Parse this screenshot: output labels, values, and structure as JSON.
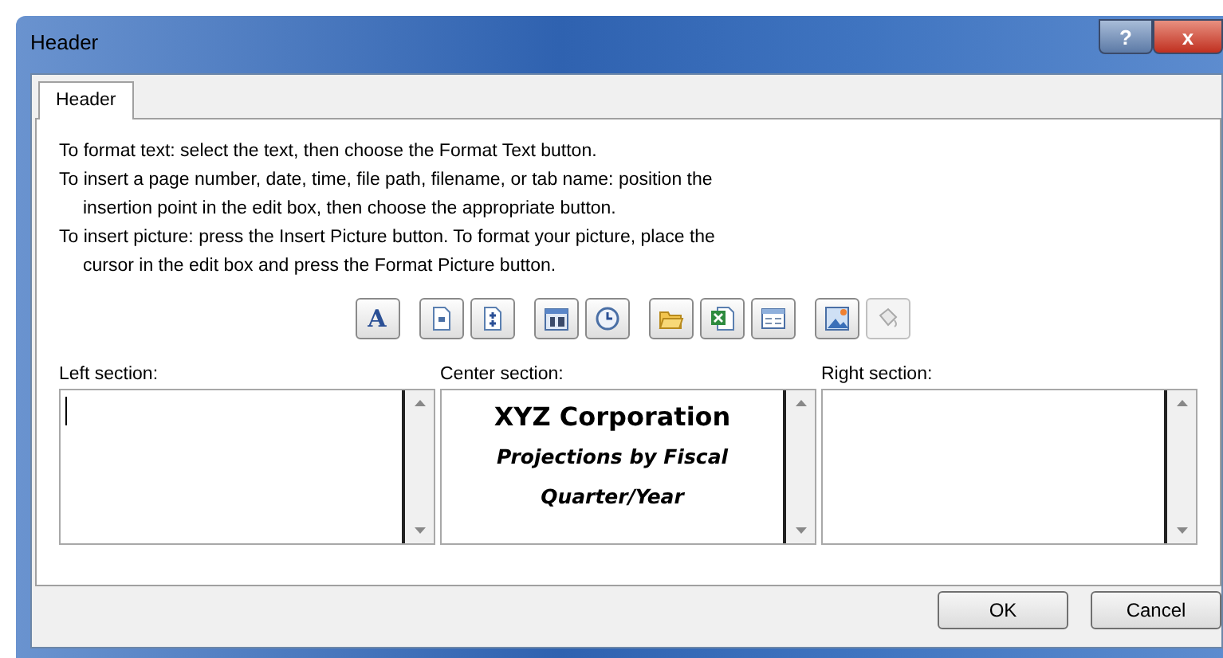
{
  "window": {
    "title": "Header"
  },
  "title_buttons": [
    {
      "kind": "help",
      "glyph": "?"
    },
    {
      "kind": "close",
      "glyph": "x"
    }
  ],
  "tabs": [
    {
      "label": "Header",
      "selected": true
    }
  ],
  "instructions": [
    {
      "text": "To format text:  select the text, then choose the Format Text button.",
      "indent": false
    },
    {
      "text": "To insert a page number, date, time, file path, filename, or tab name:  position the",
      "indent": false
    },
    {
      "text": "insertion point in the edit box, then choose the appropriate button.",
      "indent": true
    },
    {
      "text": "To insert picture: press the Insert Picture button.  To format your picture, place the",
      "indent": false
    },
    {
      "text": "cursor in the edit box and press the Format Picture button.",
      "indent": true
    }
  ],
  "toolbar": [
    [
      {
        "kind": "format-text",
        "glyph": "A",
        "disabled": false
      }
    ],
    [
      {
        "kind": "page-number",
        "disabled": false
      },
      {
        "kind": "page-count",
        "disabled": false
      }
    ],
    [
      {
        "kind": "date",
        "disabled": false
      },
      {
        "kind": "time",
        "disabled": false
      }
    ],
    [
      {
        "kind": "file-path",
        "disabled": false
      },
      {
        "kind": "filename",
        "disabled": false
      },
      {
        "kind": "sheet-name",
        "disabled": false
      }
    ],
    [
      {
        "kind": "insert-picture",
        "disabled": false
      },
      {
        "kind": "format-picture",
        "disabled": true
      }
    ]
  ],
  "sections": [
    {
      "label": "Left section:",
      "focused": true
    },
    {
      "label": "Center section:",
      "focused": false,
      "lines": [
        {
          "text": "XYZ Corporation",
          "kind": "title"
        },
        {
          "text": "Projections by Fiscal",
          "kind": "subtitle"
        },
        {
          "text": "Quarter/Year",
          "kind": "subtitle"
        }
      ]
    },
    {
      "label": "Right section:",
      "focused": false
    }
  ],
  "buttons": [
    {
      "label": "OK"
    },
    {
      "label": "Cancel"
    }
  ]
}
